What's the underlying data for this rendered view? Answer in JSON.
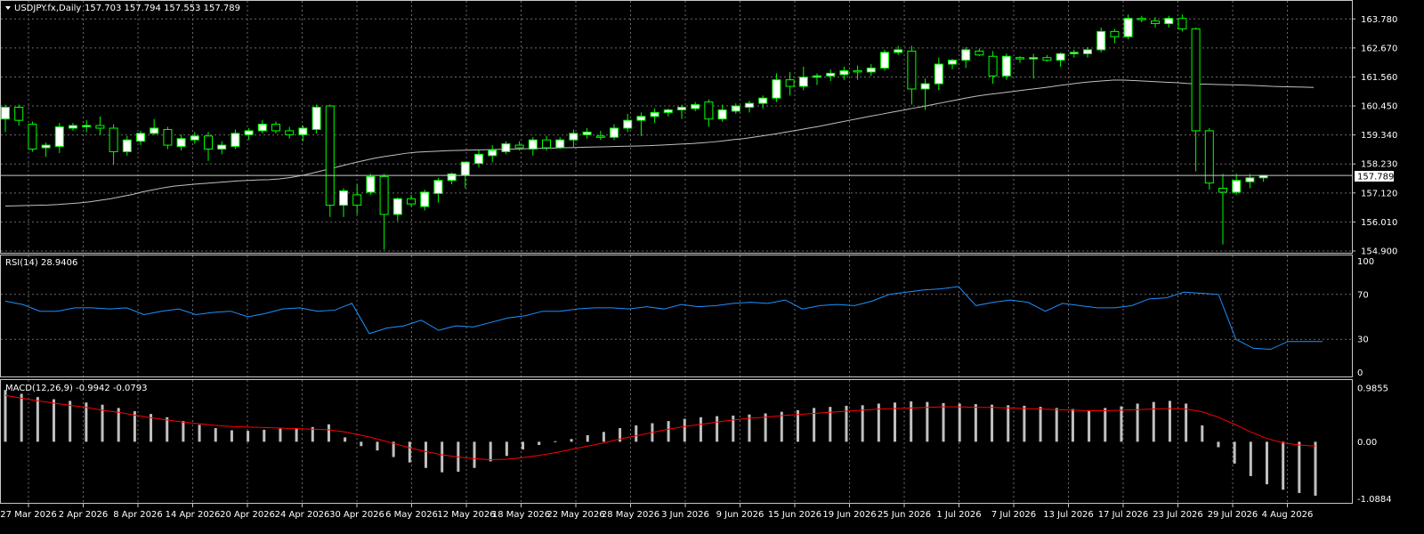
{
  "header": {
    "symbol_info": "USDJPY.fx,Daily",
    "ohlc_info": "157.703 157.794 157.553 157.789"
  },
  "current_price_label": "157.789",
  "colors": {
    "background": "#000000",
    "grid": "#6a6a6a",
    "bull_body": "#ffffff",
    "bear_body": "#000000",
    "wick": "#00ff00",
    "ma_line": "#c0c0c0",
    "rsi_line": "#1e90ff",
    "macd_histogram": "#c0c0c0",
    "macd_signal": "#ff0000"
  },
  "rsi": {
    "label": "RSI(14) 28.9406",
    "ticks": [
      "100",
      "70",
      "30",
      "0"
    ]
  },
  "macd": {
    "label": "MACD(12,26,9) -0.9942 -0.0793",
    "ticks": [
      "0.9855",
      "0.00",
      "-1.0884"
    ]
  },
  "chart_data": [
    {
      "type": "candlestick",
      "title": "USDJPY.fx,Daily",
      "x_tick_labels": [
        "27 Mar 2026",
        "2 Apr 2026",
        "8 Apr 2026",
        "14 Apr 2026",
        "20 Apr 2026",
        "24 Apr 2026",
        "30 Apr 2026",
        "6 May 2026",
        "12 May 2026",
        "18 May 2026",
        "22 May 2026",
        "28 May 2026",
        "3 Jun 2026",
        "9 Jun 2026",
        "15 Jun 2026",
        "19 Jun 2026",
        "25 Jun 2026",
        "1 Jul 2026",
        "7 Jul 2026",
        "13 Jul 2026",
        "17 Jul 2026",
        "23 Jul 2026",
        "29 Jul 2026",
        "4 Aug 2026"
      ],
      "y_tick_labels": [
        "163.780",
        "162.670",
        "161.560",
        "160.450",
        "159.340",
        "158.230",
        "157.120",
        "156.010",
        "154.900"
      ],
      "ylim": [
        154.9,
        164.3
      ],
      "bars": [
        {
          "o": 159.95,
          "h": 160.5,
          "l": 159.45,
          "c": 160.4
        },
        {
          "o": 160.4,
          "h": 160.5,
          "l": 159.7,
          "c": 159.9
        },
        {
          "o": 159.75,
          "h": 159.85,
          "l": 158.7,
          "c": 158.8
        },
        {
          "o": 158.85,
          "h": 159.05,
          "l": 158.5,
          "c": 158.95
        },
        {
          "o": 158.9,
          "h": 159.8,
          "l": 158.65,
          "c": 159.65
        },
        {
          "o": 159.6,
          "h": 159.8,
          "l": 159.5,
          "c": 159.7
        },
        {
          "o": 159.65,
          "h": 159.9,
          "l": 159.45,
          "c": 159.7
        },
        {
          "o": 159.7,
          "h": 160.05,
          "l": 159.35,
          "c": 159.6
        },
        {
          "o": 159.6,
          "h": 159.75,
          "l": 158.2,
          "c": 158.7
        },
        {
          "o": 158.7,
          "h": 159.3,
          "l": 158.55,
          "c": 159.15
        },
        {
          "o": 159.1,
          "h": 159.5,
          "l": 158.95,
          "c": 159.4
        },
        {
          "o": 159.4,
          "h": 159.95,
          "l": 159.35,
          "c": 159.6
        },
        {
          "o": 159.55,
          "h": 159.65,
          "l": 158.8,
          "c": 158.95
        },
        {
          "o": 158.9,
          "h": 159.35,
          "l": 158.75,
          "c": 159.2
        },
        {
          "o": 159.15,
          "h": 159.45,
          "l": 159.0,
          "c": 159.3
        },
        {
          "o": 159.3,
          "h": 159.45,
          "l": 158.35,
          "c": 158.8
        },
        {
          "o": 158.8,
          "h": 159.1,
          "l": 158.6,
          "c": 158.95
        },
        {
          "o": 158.9,
          "h": 159.55,
          "l": 158.8,
          "c": 159.4
        },
        {
          "o": 159.35,
          "h": 159.6,
          "l": 159.15,
          "c": 159.5
        },
        {
          "o": 159.5,
          "h": 159.9,
          "l": 159.4,
          "c": 159.75
        },
        {
          "o": 159.75,
          "h": 159.85,
          "l": 159.4,
          "c": 159.5
        },
        {
          "o": 159.5,
          "h": 159.65,
          "l": 159.2,
          "c": 159.35
        },
        {
          "o": 159.35,
          "h": 159.7,
          "l": 159.1,
          "c": 159.6
        },
        {
          "o": 159.55,
          "h": 160.5,
          "l": 159.4,
          "c": 160.4
        },
        {
          "o": 160.45,
          "h": 160.5,
          "l": 156.2,
          "c": 156.65
        },
        {
          "o": 156.65,
          "h": 157.3,
          "l": 156.2,
          "c": 157.2
        },
        {
          "o": 157.05,
          "h": 157.45,
          "l": 156.3,
          "c": 156.65
        },
        {
          "o": 157.15,
          "h": 157.85,
          "l": 157.05,
          "c": 157.75
        },
        {
          "o": 157.75,
          "h": 157.85,
          "l": 154.95,
          "c": 156.3
        },
        {
          "o": 156.3,
          "h": 156.95,
          "l": 156.05,
          "c": 156.9
        },
        {
          "o": 156.9,
          "h": 157.05,
          "l": 156.6,
          "c": 156.7
        },
        {
          "o": 156.6,
          "h": 157.25,
          "l": 156.45,
          "c": 157.15
        },
        {
          "o": 157.1,
          "h": 157.7,
          "l": 156.75,
          "c": 157.6
        },
        {
          "o": 157.6,
          "h": 157.9,
          "l": 157.45,
          "c": 157.85
        },
        {
          "o": 157.8,
          "h": 158.3,
          "l": 157.3,
          "c": 158.3
        },
        {
          "o": 158.25,
          "h": 158.75,
          "l": 158.1,
          "c": 158.6
        },
        {
          "o": 158.55,
          "h": 158.95,
          "l": 158.3,
          "c": 158.75
        },
        {
          "o": 158.7,
          "h": 159.1,
          "l": 158.6,
          "c": 159.0
        },
        {
          "o": 158.95,
          "h": 159.1,
          "l": 158.75,
          "c": 158.85
        },
        {
          "o": 158.8,
          "h": 159.25,
          "l": 158.55,
          "c": 159.15
        },
        {
          "o": 159.15,
          "h": 159.3,
          "l": 158.75,
          "c": 158.85
        },
        {
          "o": 158.85,
          "h": 159.25,
          "l": 158.8,
          "c": 159.15
        },
        {
          "o": 159.15,
          "h": 159.55,
          "l": 158.85,
          "c": 159.4
        },
        {
          "o": 159.35,
          "h": 159.6,
          "l": 159.2,
          "c": 159.45
        },
        {
          "o": 159.3,
          "h": 159.5,
          "l": 159.15,
          "c": 159.25
        },
        {
          "o": 159.25,
          "h": 159.75,
          "l": 159.15,
          "c": 159.6
        },
        {
          "o": 159.6,
          "h": 160.15,
          "l": 159.45,
          "c": 159.9
        },
        {
          "o": 159.9,
          "h": 160.2,
          "l": 159.3,
          "c": 160.05
        },
        {
          "o": 160.05,
          "h": 160.35,
          "l": 159.8,
          "c": 160.2
        },
        {
          "o": 160.2,
          "h": 160.35,
          "l": 160.05,
          "c": 160.3
        },
        {
          "o": 160.3,
          "h": 160.5,
          "l": 159.95,
          "c": 160.4
        },
        {
          "o": 160.35,
          "h": 160.6,
          "l": 160.25,
          "c": 160.5
        },
        {
          "o": 160.6,
          "h": 160.7,
          "l": 159.65,
          "c": 159.95
        },
        {
          "o": 159.95,
          "h": 160.5,
          "l": 159.85,
          "c": 160.3
        },
        {
          "o": 160.25,
          "h": 160.55,
          "l": 160.15,
          "c": 160.45
        },
        {
          "o": 160.4,
          "h": 160.65,
          "l": 160.2,
          "c": 160.55
        },
        {
          "o": 160.55,
          "h": 160.85,
          "l": 160.35,
          "c": 160.75
        },
        {
          "o": 160.75,
          "h": 161.7,
          "l": 160.6,
          "c": 161.45
        },
        {
          "o": 161.45,
          "h": 161.75,
          "l": 160.85,
          "c": 161.2
        },
        {
          "o": 161.2,
          "h": 161.95,
          "l": 161.05,
          "c": 161.55
        },
        {
          "o": 161.55,
          "h": 161.7,
          "l": 161.25,
          "c": 161.6
        },
        {
          "o": 161.6,
          "h": 161.85,
          "l": 161.4,
          "c": 161.7
        },
        {
          "o": 161.65,
          "h": 161.95,
          "l": 161.45,
          "c": 161.8
        },
        {
          "o": 161.8,
          "h": 162.0,
          "l": 161.45,
          "c": 161.75
        },
        {
          "o": 161.75,
          "h": 162.05,
          "l": 161.6,
          "c": 161.9
        },
        {
          "o": 161.9,
          "h": 162.6,
          "l": 161.8,
          "c": 162.5
        },
        {
          "o": 162.5,
          "h": 162.75,
          "l": 162.4,
          "c": 162.6
        },
        {
          "o": 162.55,
          "h": 162.75,
          "l": 160.5,
          "c": 161.1
        },
        {
          "o": 161.1,
          "h": 161.5,
          "l": 160.3,
          "c": 161.3
        },
        {
          "o": 161.3,
          "h": 162.3,
          "l": 161.05,
          "c": 162.05
        },
        {
          "o": 162.05,
          "h": 162.25,
          "l": 161.85,
          "c": 162.2
        },
        {
          "o": 162.2,
          "h": 162.7,
          "l": 161.9,
          "c": 162.6
        },
        {
          "o": 162.55,
          "h": 162.65,
          "l": 162.35,
          "c": 162.4
        },
        {
          "o": 162.35,
          "h": 162.55,
          "l": 161.3,
          "c": 161.6
        },
        {
          "o": 161.6,
          "h": 162.45,
          "l": 161.45,
          "c": 162.35
        },
        {
          "o": 162.3,
          "h": 162.35,
          "l": 162.1,
          "c": 162.25
        },
        {
          "o": 162.25,
          "h": 162.45,
          "l": 161.5,
          "c": 162.3
        },
        {
          "o": 162.3,
          "h": 162.4,
          "l": 162.15,
          "c": 162.2
        },
        {
          "o": 162.2,
          "h": 162.5,
          "l": 161.95,
          "c": 162.45
        },
        {
          "o": 162.45,
          "h": 162.6,
          "l": 162.3,
          "c": 162.5
        },
        {
          "o": 162.45,
          "h": 162.7,
          "l": 162.3,
          "c": 162.6
        },
        {
          "o": 162.6,
          "h": 163.45,
          "l": 162.5,
          "c": 163.3
        },
        {
          "o": 163.3,
          "h": 163.4,
          "l": 162.85,
          "c": 163.1
        },
        {
          "o": 163.1,
          "h": 163.95,
          "l": 163.0,
          "c": 163.8
        },
        {
          "o": 163.8,
          "h": 163.9,
          "l": 163.65,
          "c": 163.75
        },
        {
          "o": 163.7,
          "h": 163.85,
          "l": 163.45,
          "c": 163.6
        },
        {
          "o": 163.6,
          "h": 163.9,
          "l": 163.45,
          "c": 163.8
        },
        {
          "o": 163.8,
          "h": 163.95,
          "l": 163.3,
          "c": 163.4
        },
        {
          "o": 163.4,
          "h": 163.45,
          "l": 157.95,
          "c": 159.5
        },
        {
          "o": 159.5,
          "h": 159.6,
          "l": 157.25,
          "c": 157.5
        },
        {
          "o": 157.3,
          "h": 157.85,
          "l": 155.15,
          "c": 157.15
        },
        {
          "o": 157.15,
          "h": 157.85,
          "l": 157.05,
          "c": 157.6
        },
        {
          "o": 157.55,
          "h": 157.85,
          "l": 157.3,
          "c": 157.7
        },
        {
          "o": 157.7,
          "h": 157.79,
          "l": 157.55,
          "c": 157.79
        }
      ],
      "ma_series": [
        156.62,
        156.63,
        156.64,
        156.65,
        156.66,
        156.68,
        156.71,
        156.74,
        156.78,
        156.84,
        156.9,
        156.98,
        157.06,
        157.16,
        157.24,
        157.32,
        157.38,
        157.42,
        157.46,
        157.49,
        157.52,
        157.55,
        157.58,
        157.6,
        157.62,
        157.63,
        157.66,
        157.71,
        157.78,
        157.87,
        157.97,
        158.07,
        158.17,
        158.27,
        158.36,
        158.45,
        158.52,
        158.58,
        158.64,
        158.68,
        158.7,
        158.72,
        158.74,
        158.75,
        158.76,
        158.77,
        158.78,
        158.79,
        158.8,
        158.81,
        158.82,
        158.83,
        158.84,
        158.85,
        158.86,
        158.87,
        158.88,
        158.89,
        158.9,
        158.91,
        158.92,
        158.93,
        158.95,
        158.97,
        158.99,
        159.01,
        159.04,
        159.07,
        159.11,
        159.16,
        159.2,
        159.26,
        159.32,
        159.38,
        159.45,
        159.52,
        159.59,
        159.66,
        159.74,
        159.82,
        159.9,
        159.98,
        160.06,
        160.13,
        160.21,
        160.28,
        160.36,
        160.43,
        160.51,
        160.59,
        160.67,
        160.75,
        160.82,
        160.88,
        160.93,
        160.98,
        161.03,
        161.08,
        161.13,
        161.18,
        161.24,
        161.29,
        161.34,
        161.38,
        161.41,
        161.44,
        161.44,
        161.42,
        161.4,
        161.38,
        161.36,
        161.34,
        161.31,
        161.29,
        161.28,
        161.27,
        161.26,
        161.25,
        161.24,
        161.22,
        161.2,
        161.19,
        161.18,
        161.17,
        161.16
      ],
      "current_price": 157.789
    },
    {
      "type": "line",
      "name": "RSI(14) 28.9406",
      "ylim": [
        0,
        100
      ],
      "y_ticks": [
        100,
        70,
        30,
        0
      ],
      "values": [
        64,
        61,
        55,
        55,
        58,
        58,
        57,
        58,
        52,
        55,
        57,
        52,
        54,
        55,
        50,
        53,
        57,
        58,
        55,
        56,
        62,
        35,
        40,
        42,
        47,
        38,
        42,
        41,
        45,
        49,
        51,
        55,
        55,
        57,
        58,
        58,
        57,
        59,
        57,
        61,
        59,
        60,
        62,
        63,
        62,
        65,
        57,
        60,
        61,
        60,
        64,
        70,
        72,
        74,
        75,
        77,
        60,
        63,
        65,
        63,
        55,
        62,
        60,
        58,
        58,
        60,
        66,
        67,
        72,
        71,
        70,
        30,
        22,
        21,
        28,
        28,
        28
      ],
      "current": 28.9406
    },
    {
      "type": "bar",
      "name": "MACD(12,26,9) -0.9942 -0.0793",
      "ylim": [
        -1.0884,
        0.9855
      ],
      "histogram": [
        0.95,
        0.88,
        0.82,
        0.78,
        0.75,
        0.72,
        0.68,
        0.62,
        0.56,
        0.51,
        0.45,
        0.38,
        0.31,
        0.25,
        0.21,
        0.2,
        0.22,
        0.24,
        0.25,
        0.27,
        0.32,
        0.08,
        -0.08,
        -0.16,
        -0.28,
        -0.38,
        -0.48,
        -0.56,
        -0.55,
        -0.48,
        -0.36,
        -0.26,
        -0.14,
        -0.06,
        0.01,
        0.05,
        0.12,
        0.18,
        0.25,
        0.3,
        0.34,
        0.38,
        0.42,
        0.45,
        0.47,
        0.48,
        0.5,
        0.52,
        0.55,
        0.58,
        0.62,
        0.64,
        0.66,
        0.67,
        0.7,
        0.72,
        0.74,
        0.73,
        0.71,
        0.7,
        0.69,
        0.68,
        0.67,
        0.66,
        0.64,
        0.62,
        0.6,
        0.58,
        0.62,
        0.65,
        0.7,
        0.73,
        0.75,
        0.7,
        0.3,
        -0.1,
        -0.4,
        -0.63,
        -0.78,
        -0.88,
        -0.94,
        -0.99
      ],
      "signal": [
        0.85,
        0.8,
        0.75,
        0.71,
        0.67,
        0.63,
        0.58,
        0.54,
        0.49,
        0.44,
        0.4,
        0.36,
        0.33,
        0.3,
        0.28,
        0.27,
        0.26,
        0.25,
        0.24,
        0.23,
        0.22,
        0.18,
        0.12,
        0.05,
        -0.03,
        -0.11,
        -0.18,
        -0.24,
        -0.28,
        -0.31,
        -0.33,
        -0.32,
        -0.29,
        -0.25,
        -0.2,
        -0.14,
        -0.08,
        -0.02,
        0.05,
        0.11,
        0.17,
        0.23,
        0.28,
        0.32,
        0.36,
        0.4,
        0.43,
        0.45,
        0.48,
        0.5,
        0.52,
        0.54,
        0.56,
        0.58,
        0.6,
        0.61,
        0.62,
        0.63,
        0.64,
        0.64,
        0.63,
        0.63,
        0.62,
        0.61,
        0.6,
        0.59,
        0.58,
        0.57,
        0.57,
        0.58,
        0.59,
        0.6,
        0.61,
        0.6,
        0.55,
        0.45,
        0.32,
        0.18,
        0.06,
        -0.02,
        -0.06,
        -0.08
      ],
      "current_macd": -0.9942,
      "current_signal": -0.0793
    }
  ]
}
